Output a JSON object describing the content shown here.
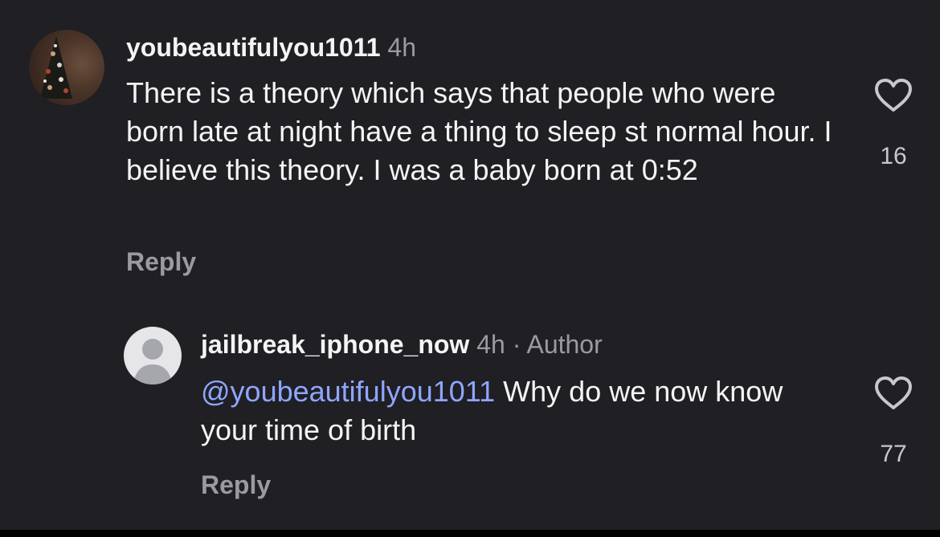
{
  "comments": [
    {
      "username": "youbeautifulyou1011",
      "time": "4h",
      "text": "There is a theory which says that people who were born late at night have a thing to sleep st normal hour. I believe this theory. I was a baby born at 0:52",
      "reply_label": "Reply",
      "likes": "16",
      "icons": {
        "like": "heart-icon",
        "avatar": "christmas-tree-photo"
      }
    }
  ],
  "reply": {
    "username": "jailbreak_iphone_now",
    "time": "4h",
    "separator": "·",
    "author_badge": "Author",
    "mention": "@youbeautifulyou1011",
    "text": "Why do we now know your time of birth",
    "reply_label": "Reply",
    "likes": "77",
    "icons": {
      "like": "heart-icon",
      "avatar": "default-user-avatar"
    }
  },
  "colors": {
    "background": "#1f1f24",
    "mention": "#8fa6ff",
    "secondary_text": "#9a9aa2"
  }
}
